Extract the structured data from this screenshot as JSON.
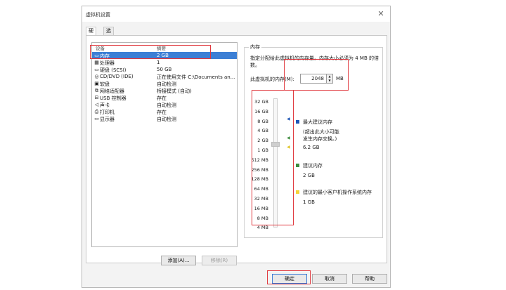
{
  "window": {
    "title": "虚拟机设置",
    "close_glyph": "✕"
  },
  "tabs": [
    {
      "label": "硬件"
    },
    {
      "label": "选项"
    }
  ],
  "device_list": {
    "header": {
      "device": "设备",
      "summary": "摘要"
    },
    "rows": [
      {
        "name": "内存",
        "summary": "2 GB",
        "icon": "memory-icon",
        "glyph": "▭"
      },
      {
        "name": "处理器",
        "summary": "1",
        "icon": "processor-icon",
        "glyph": "▦"
      },
      {
        "name": "硬盘 (SCSI)",
        "summary": "50 GB",
        "icon": "hard-disk-icon",
        "glyph": "▭"
      },
      {
        "name": "CD/DVD (IDE)",
        "summary": "正在使用文件 C:\\Documents an...",
        "icon": "cd-dvd-icon",
        "glyph": "◎"
      },
      {
        "name": "软盘",
        "summary": "自动检测",
        "icon": "floppy-icon",
        "glyph": "▣"
      },
      {
        "name": "网络适配器",
        "summary": "桥接模式 (自动)",
        "icon": "network-icon",
        "glyph": "⧉"
      },
      {
        "name": "USB 控制器",
        "summary": "存在",
        "icon": "usb-icon",
        "glyph": "⊟"
      },
      {
        "name": "声卡",
        "summary": "自动检测",
        "icon": "sound-icon",
        "glyph": "◁"
      },
      {
        "name": "打印机",
        "summary": "存在",
        "icon": "printer-icon",
        "glyph": "⎙"
      },
      {
        "name": "显示器",
        "summary": "自动检测",
        "icon": "display-icon",
        "glyph": "▭"
      }
    ]
  },
  "list_buttons": {
    "add": "添加(A)...",
    "remove": "移除(R)"
  },
  "memory": {
    "group_title": "内存",
    "description": "指定分配给此虚拟机的内存量。内存大小必须为 4 MB 的倍数。",
    "label": "此虚拟机的内存(M):",
    "value": "2048",
    "unit": "MB",
    "scale": [
      "32 GB",
      "16 GB",
      "8 GB",
      "4 GB",
      "2 GB",
      "1 GB",
      "512 MB",
      "256 MB",
      "128 MB",
      "64 MB",
      "32 MB",
      "16 MB",
      "8 MB",
      "4 MB"
    ],
    "legend": {
      "max": {
        "title": "最大建议内存",
        "note": "(超出此大小可能\n发生内存交换。)",
        "value": "6.2 GB",
        "color": "#1f56b5"
      },
      "recommended": {
        "title": "建议内存",
        "value": "2 GB",
        "color": "#3d8b3d"
      },
      "min": {
        "title": "建议的最小客户机操作系统内存",
        "value": "1 GB",
        "color": "#f5d33a"
      }
    }
  },
  "footer_buttons": {
    "ok": "确定",
    "cancel": "取消",
    "help": "帮助"
  },
  "highlight_color": "#e0383e"
}
